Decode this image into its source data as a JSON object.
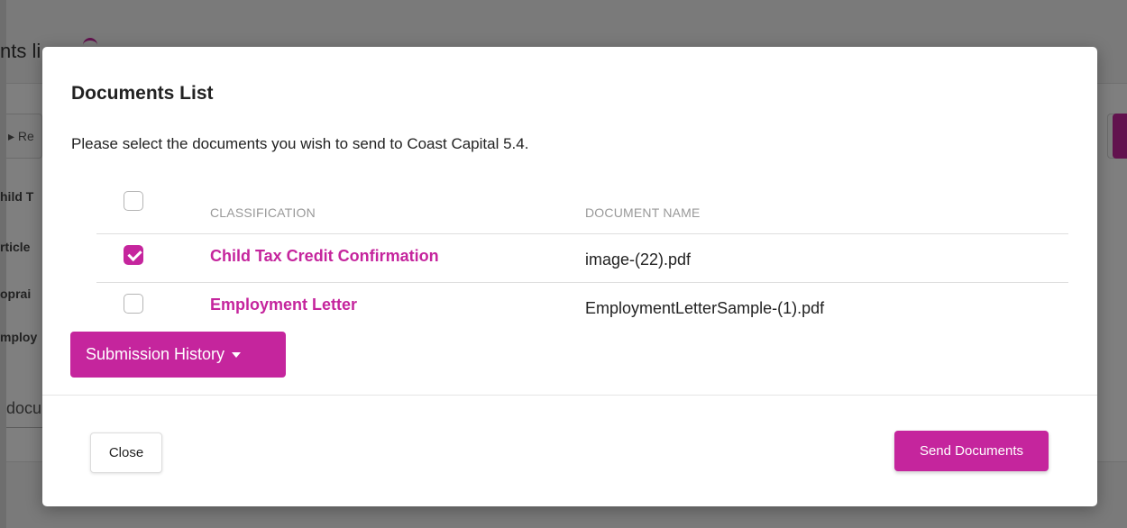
{
  "background": {
    "title_fragment": "nts li",
    "toolbar_fragment": "Re",
    "row_fragments": [
      "hild T",
      "rticle",
      "oprai",
      "mploy"
    ],
    "search_fragment": "docu"
  },
  "modal": {
    "title": "Documents List",
    "description": "Please select the documents you wish to send to Coast Capital 5.4.",
    "columns": {
      "classification": "CLASSIFICATION",
      "document_name": "DOCUMENT NAME"
    },
    "documents": [
      {
        "classification": "Child Tax Credit Confirmation",
        "document_name": "image-(22).pdf",
        "checked": true
      },
      {
        "classification": "Employment Letter",
        "document_name": "EmploymentLetterSample-(1).pdf",
        "checked": false
      }
    ],
    "submission_history_label": "Submission History",
    "close_label": "Close",
    "send_label": "Send Documents"
  },
  "colors": {
    "accent": "#c5259d",
    "overlay": "rgba(0,0,0,0.5)"
  }
}
